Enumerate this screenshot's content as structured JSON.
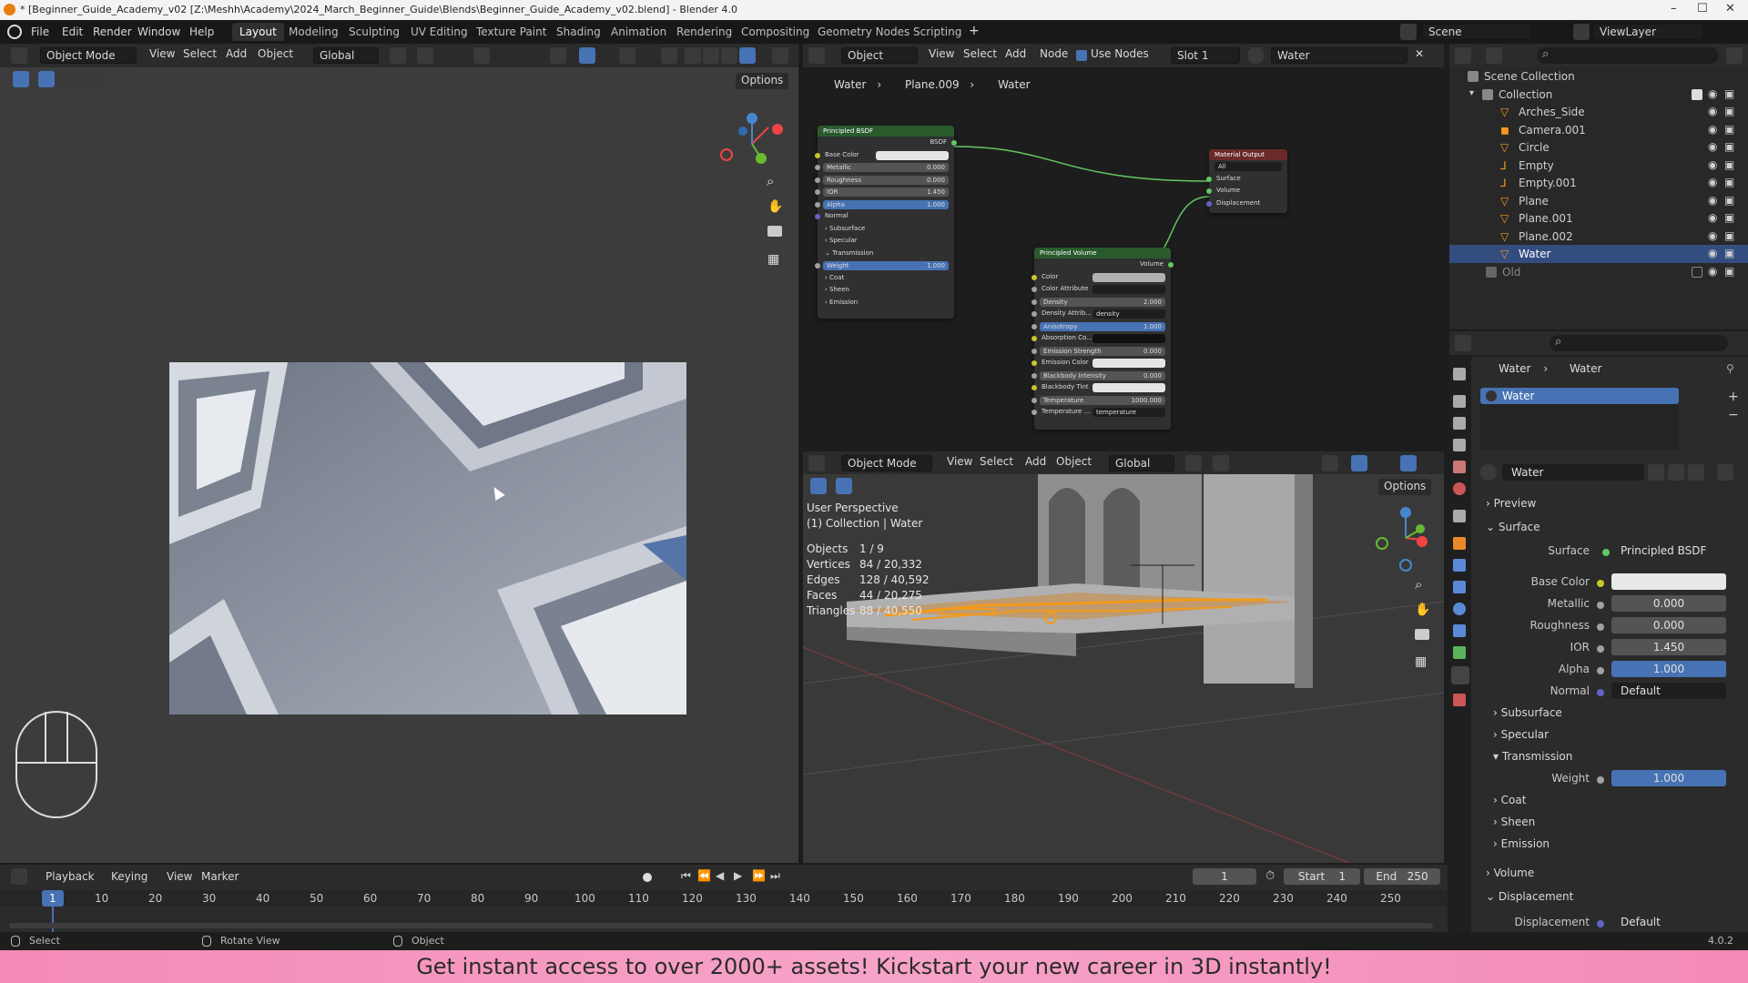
{
  "window_title": "* [Beginner_Guide_Academy_v02 [Z:\\Meshh\\Academy\\2024_March_Beginner_Guide\\Blends\\Beginner_Guide_Academy_v02.blend] - Blender 4.0",
  "menu": [
    "File",
    "Edit",
    "Render",
    "Window",
    "Help"
  ],
  "workspaces": [
    "Layout",
    "Modeling",
    "Sculpting",
    "UV Editing",
    "Texture Paint",
    "Shading",
    "Animation",
    "Rendering",
    "Compositing",
    "Geometry Nodes",
    "Scripting"
  ],
  "scene": "Scene",
  "view_layer": "ViewLayer",
  "left_viewport": {
    "mode": "Object Mode",
    "view": "View",
    "select": "Select",
    "add": "Add",
    "object": "Object",
    "orientation": "Global",
    "options": "Options"
  },
  "node_editor": {
    "type": "Object",
    "view": "View",
    "select": "Select",
    "add": "Add",
    "node": "Node",
    "use_nodes": "Use Nodes",
    "slot": "Slot 1",
    "material": "Water",
    "breadcrumb": [
      "Water",
      "Plane.009",
      "Water"
    ],
    "bsdf": {
      "title": "Principled BSDF",
      "out": "BSDF",
      "base_color": "Base Color",
      "metallic": "Metallic",
      "metallic_v": "0.000",
      "roughness": "Roughness",
      "roughness_v": "0.000",
      "ior": "IOR",
      "ior_v": "1.450",
      "alpha": "Alpha",
      "alpha_v": "1.000",
      "normal": "Normal",
      "subsurface": "Subsurface",
      "specular": "Specular",
      "transmission": "Transmission",
      "weight": "Weight",
      "weight_v": "1.000",
      "coat": "Coat",
      "sheen": "Sheen",
      "emission": "Emission"
    },
    "output": {
      "title": "Material Output",
      "target": "All",
      "surface": "Surface",
      "volume": "Volume",
      "displacement": "Displacement"
    },
    "volume": {
      "title": "Principled Volume",
      "out": "Volume",
      "color": "Color",
      "color_attr": "Color Attribute",
      "density": "Density",
      "density_v": "2.000",
      "density_attr": "Density Attrib...",
      "density_attr_v": "density",
      "anisotropy": "Anisotropy",
      "anisotropy_v": "1.000",
      "absorption": "Absorption Co...",
      "emission_strength": "Emission Strength",
      "emission_strength_v": "0.000",
      "emission_color": "Emission Color",
      "blackbody_intensity": "Blackbody Intensity",
      "blackbody_intensity_v": "0.000",
      "blackbody_tint": "Blackbody Tint",
      "temperature": "Temperature",
      "temperature_v": "1000.000",
      "temperature_attr": "Temperature ...",
      "temperature_attr_v": "temperature"
    }
  },
  "right_viewport": {
    "mode": "Object Mode",
    "view": "View",
    "select": "Select",
    "add": "Add",
    "object": "Object",
    "orientation": "Global",
    "options": "Options",
    "perspective": "User Perspective",
    "collection": "(1) Collection | Water",
    "stats": [
      {
        "label": "Objects",
        "value": "1 / 9"
      },
      {
        "label": "Vertices",
        "value": "84 / 20,332"
      },
      {
        "label": "Edges",
        "value": "128 / 40,592"
      },
      {
        "label": "Faces",
        "value": "44 / 20,275"
      },
      {
        "label": "Triangles",
        "value": "88 / 40,550"
      }
    ]
  },
  "outliner": {
    "scene_collection": "Scene Collection",
    "collection": "Collection",
    "items": [
      "Arches_Side",
      "Camera.001",
      "Circle",
      "Empty",
      "Empty.001",
      "Plane",
      "Plane.001",
      "Plane.002",
      "Water"
    ],
    "old": "Old"
  },
  "properties": {
    "breadcrumb": [
      "Water",
      "Water"
    ],
    "slot": "Water",
    "material": "Water",
    "preview": "Preview",
    "surface_section": "Surface",
    "surface_label": "Surface",
    "surface_value": "Principled BSDF",
    "base_color": "Base Color",
    "metallic": "Metallic",
    "metallic_v": "0.000",
    "roughness": "Roughness",
    "roughness_v": "0.000",
    "ior": "IOR",
    "ior_v": "1.450",
    "alpha": "Alpha",
    "alpha_v": "1.000",
    "normal": "Normal",
    "normal_v": "Default",
    "subsurface": "Subsurface",
    "specular": "Specular",
    "transmission": "Transmission",
    "weight": "Weight",
    "weight_v": "1.000",
    "coat": "Coat",
    "sheen": "Sheen",
    "emission": "Emission",
    "volume": "Volume",
    "displacement_section": "Displacement",
    "displacement": "Displacement",
    "displacement_v": "Default",
    "version": "4.0.2"
  },
  "timeline": {
    "playback": "Playback",
    "keying": "Keying",
    "view": "View",
    "marker": "Marker",
    "current": "1",
    "start_label": "Start",
    "start": "1",
    "end_label": "End",
    "end": "250",
    "ticks": [
      "1",
      "10",
      "20",
      "30",
      "40",
      "50",
      "60",
      "70",
      "80",
      "90",
      "100",
      "110",
      "120",
      "130",
      "140",
      "150",
      "160",
      "170",
      "180",
      "190",
      "200",
      "210",
      "220",
      "230",
      "240",
      "250"
    ]
  },
  "status": {
    "select": "Select",
    "rotate": "Rotate View",
    "object": "Object"
  },
  "banner": "Get instant access to over 2000+ assets! Kickstart your new career in 3D instantly!"
}
